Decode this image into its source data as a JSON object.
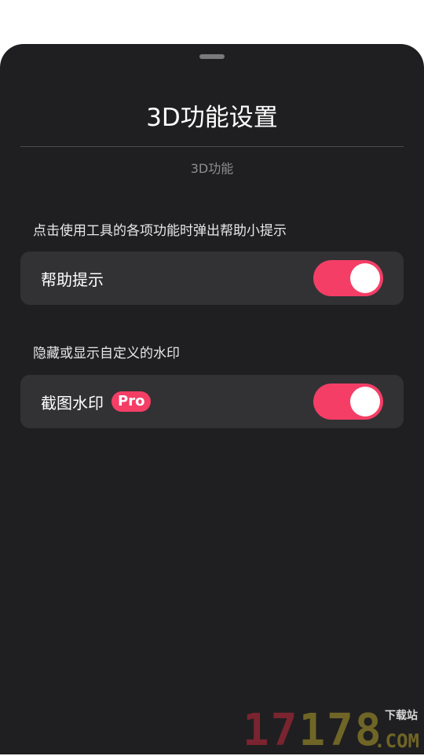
{
  "sheet": {
    "title": "3D功能设置",
    "subtitle": "3D功能"
  },
  "sections": [
    {
      "description": "点击使用工具的各项功能时弹出帮助小提示",
      "setting_label": "帮助提示",
      "toggle_on": true
    },
    {
      "description": "隐藏或显示自定义的水印",
      "setting_label": "截图水印",
      "badge": "Pro",
      "toggle_on": true
    }
  ],
  "watermark": {
    "number_a": "17",
    "number_b": "178",
    "com": ".COM",
    "download": "下载站"
  },
  "colors": {
    "accent": "#f43e66",
    "sheet_bg": "#1f1f21",
    "card_bg": "#323235"
  }
}
